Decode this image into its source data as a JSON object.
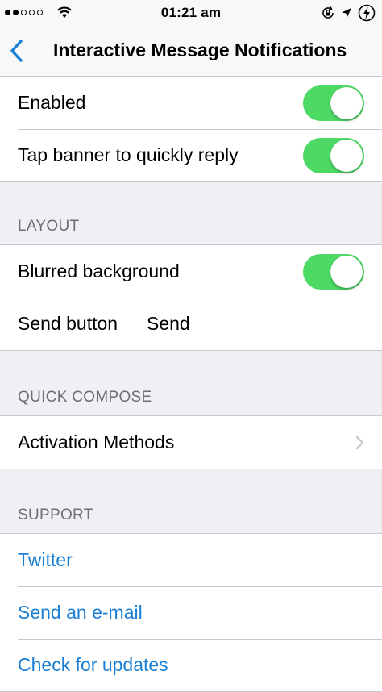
{
  "status_bar": {
    "signal": [
      true,
      true,
      false,
      false,
      false
    ],
    "time": "01:21 am",
    "icons": [
      "wifi-icon",
      "rotation-lock-icon",
      "location-arrow-icon",
      "charging-battery-icon"
    ]
  },
  "nav": {
    "back_icon": "chevron-left-icon",
    "title": "Interactive Message Notifications"
  },
  "general": {
    "enabled": {
      "label": "Enabled",
      "on": true
    },
    "tap_reply": {
      "label": "Tap banner to quickly reply",
      "on": true
    }
  },
  "layout": {
    "header": "LAYOUT",
    "blurred": {
      "label": "Blurred background",
      "on": true
    },
    "send_button": {
      "label": "Send button",
      "value": "Send"
    }
  },
  "quick_compose": {
    "header": "QUICK COMPOSE",
    "activation": {
      "label": "Activation Methods"
    }
  },
  "support": {
    "header": "SUPPORT",
    "twitter": "Twitter",
    "email": "Send an e-mail",
    "updates": "Check for updates"
  },
  "colors": {
    "accent": "#1a7fd4",
    "toggle_on": "#4cd964",
    "background": "#efeff4",
    "section_text": "#6d6d72"
  }
}
